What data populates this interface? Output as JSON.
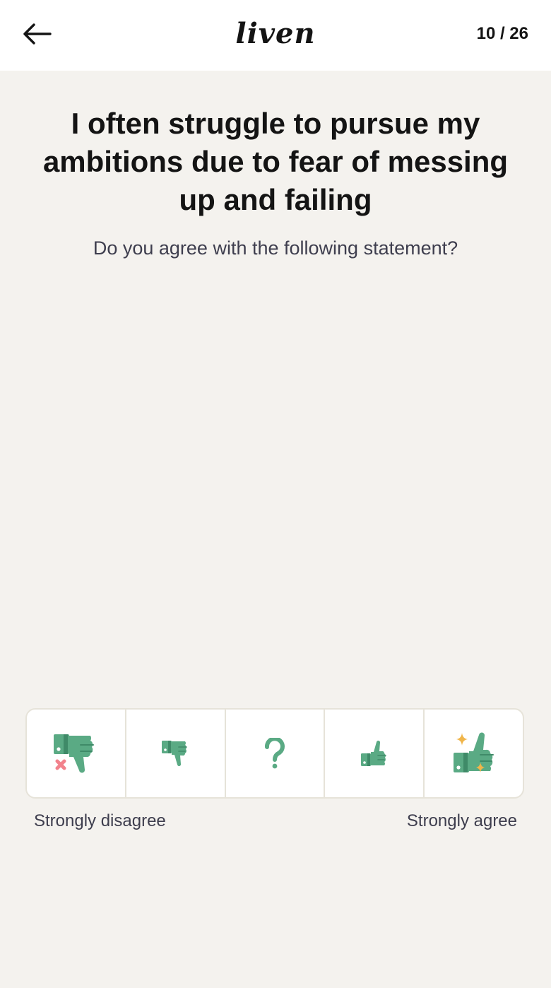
{
  "header": {
    "back_icon": "arrow-left-icon",
    "logo": "liven",
    "progress": "10 / 26"
  },
  "question": {
    "statement": "I often struggle to pursue my ambitions due to fear of messing up and failing",
    "prompt": "Do you agree with the following statement?"
  },
  "scale": {
    "options": [
      {
        "icon": "strongly-disagree-icon"
      },
      {
        "icon": "disagree-icon"
      },
      {
        "icon": "question-mark-icon"
      },
      {
        "icon": "agree-icon"
      },
      {
        "icon": "strongly-agree-icon"
      }
    ],
    "left_label": "Strongly disagree",
    "right_label": "Strongly agree"
  },
  "colors": {
    "background": "#f4f2ee",
    "header": "#ffffff",
    "icon_green": "#5aaa84",
    "icon_dark_green": "#3f8a68",
    "cross_pink": "#f2828c",
    "sparkle_gold": "#f0b54a",
    "border": "#e6e3d9"
  }
}
